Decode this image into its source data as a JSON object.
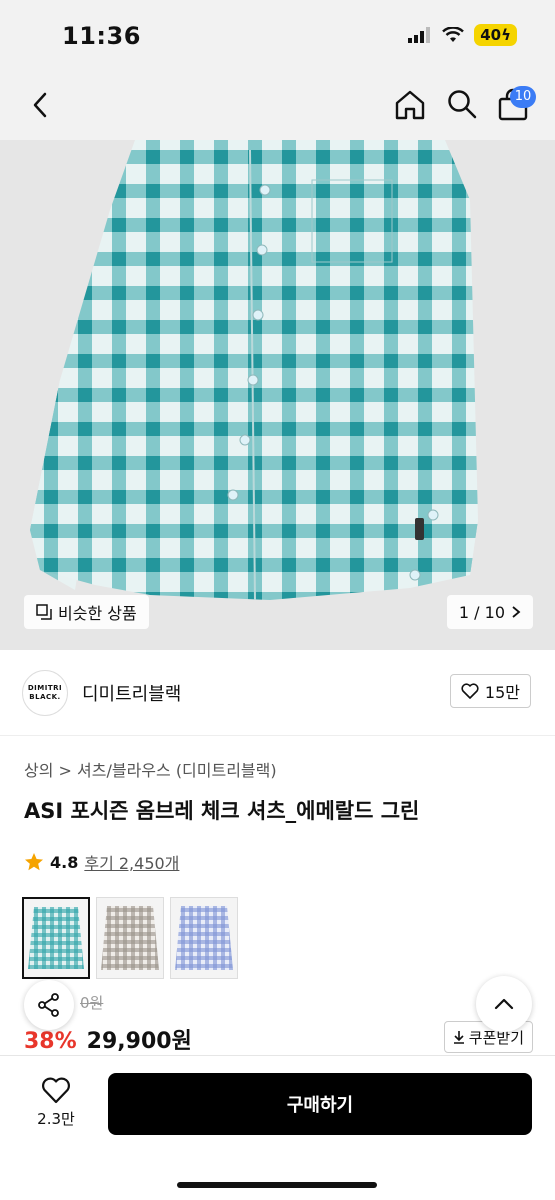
{
  "status_bar": {
    "time": "11:36",
    "battery": "40"
  },
  "nav": {
    "cart_badge": "10"
  },
  "gallery": {
    "similar_label": "비슷한 상품",
    "page_counter": "1 / 10"
  },
  "brand": {
    "logo_line1": "DIMITRI",
    "logo_line2": "BLACK.",
    "name": "디미트리블랙",
    "likes": "15만"
  },
  "product": {
    "breadcrumb": "상의 > 셔츠/블라우스 (디미트리블랙)",
    "title": "ASI 포시즌 옴브레 체크 셔츠_에메랄드 그린",
    "rating": "4.8",
    "reviews_label": "후기 2,450개",
    "thumbnails": [
      {
        "name": "emerald-green",
        "color": "#2fa3a8",
        "selected": true
      },
      {
        "name": "grey-beige",
        "color": "#9a938a",
        "selected": false
      },
      {
        "name": "blue",
        "color": "#7f95d6",
        "selected": false
      }
    ],
    "original_price_partial": "0원",
    "discount": "38%",
    "sale_price": "29,900원",
    "coupon_label": "쿠폰받기"
  },
  "bottom_bar": {
    "wish_count": "2.3만",
    "buy_label": "구매하기"
  },
  "colors": {
    "accent_blue": "#3b7cf5",
    "discount_red": "#e8362b",
    "plaid_teal": "#2fa3a8"
  }
}
